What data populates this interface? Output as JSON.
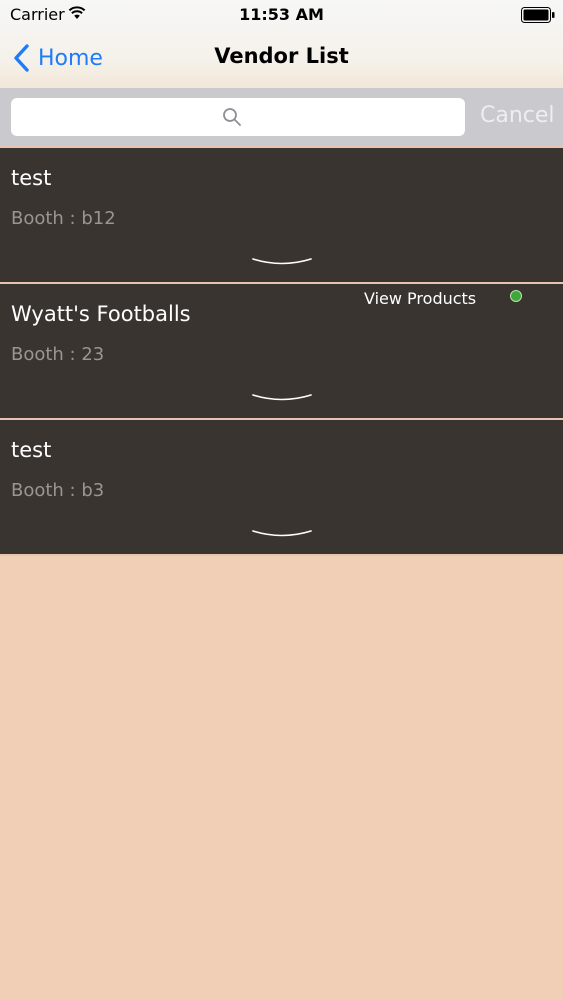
{
  "status_bar": {
    "carrier": "Carrier",
    "time": "11:53 AM"
  },
  "nav_bar": {
    "back_label": "Home",
    "title": "Vendor List"
  },
  "search": {
    "placeholder": "",
    "value": "",
    "cancel_label": "Cancel"
  },
  "vendors": [
    {
      "name": "test",
      "booth": "Booth : b12"
    },
    {
      "name": "Wyatt's Footballs",
      "booth": "Booth : 23",
      "action_label": "View Products",
      "status_color": "#3fa83a"
    },
    {
      "name": "test",
      "booth": "Booth : b3"
    }
  ],
  "colors": {
    "accent": "#1f7cf6",
    "row_background": "#3a3431",
    "page_background": "#f0cfb6",
    "search_background": "#c9c9ce"
  },
  "icons": {
    "back": "chevron-left-icon",
    "search": "magnifier-icon",
    "expand": "chevron-down-icon",
    "wifi": "wifi-icon",
    "battery": "battery-icon"
  }
}
